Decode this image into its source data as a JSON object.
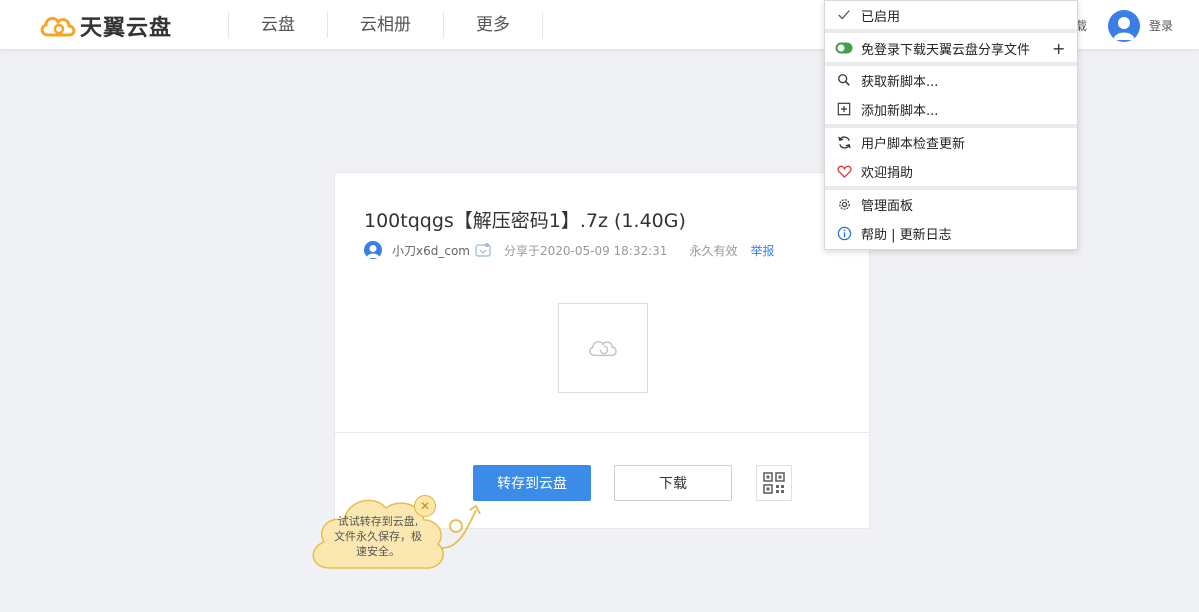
{
  "header": {
    "logo_text": "天翼云盘",
    "nav": [
      "云盘",
      "云相册",
      "更多"
    ],
    "partial_text": "载",
    "login_label": "登录"
  },
  "file": {
    "title": "100tqqgs【解压密码1】.7z (1.40G)",
    "username": "小刀x6d_com",
    "shared": "分享于2020-05-09 18:32:31",
    "validity": "永久有效",
    "report": "举报"
  },
  "actions": {
    "save": "转存到云盘",
    "download": "下载"
  },
  "tip": {
    "lines": [
      "试试转存到云盘,",
      "文件永久保存，极",
      "速安全。"
    ]
  },
  "menu": {
    "enabled": "已启用",
    "script_name": "免登录下载天翼云盘分享文件",
    "get_scripts": "获取新脚本...",
    "add_script": "添加新脚本...",
    "check_updates": "用户脚本检查更新",
    "donate": "欢迎捐助",
    "dashboard": "管理面板",
    "help": "帮助 | 更新日志"
  },
  "colors": {
    "brand_orange": "#f5a623",
    "primary_blue": "#3b8be8",
    "toggle_green": "#43a047",
    "heart_red": "#e53935"
  }
}
